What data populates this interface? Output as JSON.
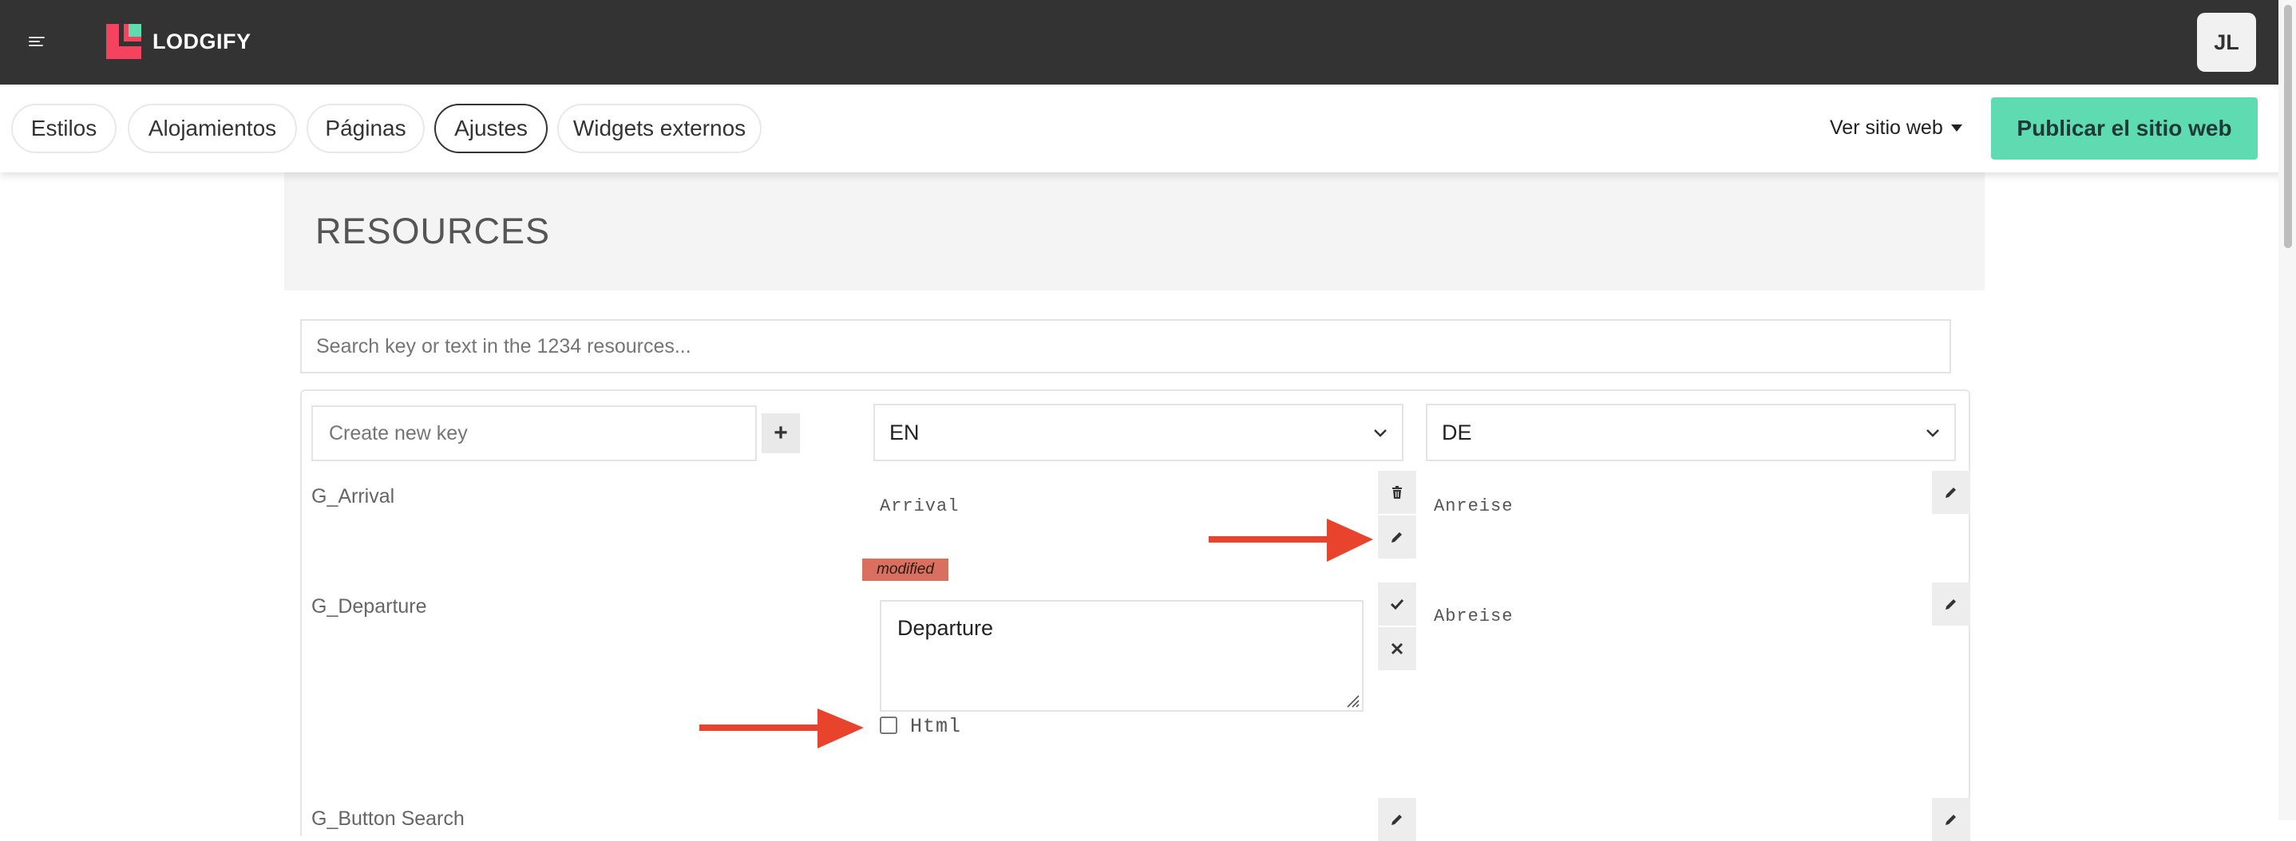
{
  "brand": {
    "name": "LODGIFY",
    "logo_colors": {
      "red": "#f3435e",
      "teal": "#5fdbb1"
    }
  },
  "user": {
    "initials": "JL"
  },
  "nav": {
    "tabs": [
      {
        "label": "Estilos",
        "active": false
      },
      {
        "label": "Alojamientos",
        "active": false
      },
      {
        "label": "Páginas",
        "active": false
      },
      {
        "label": "Ajustes",
        "active": true
      },
      {
        "label": "Widgets externos",
        "active": false
      }
    ],
    "view_site": "Ver sitio web",
    "publish": "Publicar el sitio web"
  },
  "resources": {
    "title": "RESOURCES",
    "search_placeholder": "Search key or text in the 1234 resources...",
    "create_placeholder": "Create new key",
    "add_button": "+",
    "lang_left": "EN",
    "lang_right": "DE",
    "rows": [
      {
        "key": "G_Arrival",
        "en": "Arrival",
        "de": "Anreise"
      },
      {
        "key": "G_Departure",
        "en": "Departure",
        "de": "Abreise",
        "badge": "modified",
        "html_label": "Html",
        "html_checked": false
      },
      {
        "key": "G_Button Search",
        "en": "",
        "de": ""
      }
    ]
  },
  "colors": {
    "topbar": "#333333",
    "publish_bg": "#5fdbb1",
    "modified_badge": "#d9705f",
    "annotation_arrow": "#e8432d"
  },
  "icons": [
    "hamburger-icon",
    "trash-icon",
    "pencil-icon",
    "check-icon",
    "close-icon",
    "plus-icon",
    "chevron-down-icon",
    "caret-down-icon"
  ]
}
